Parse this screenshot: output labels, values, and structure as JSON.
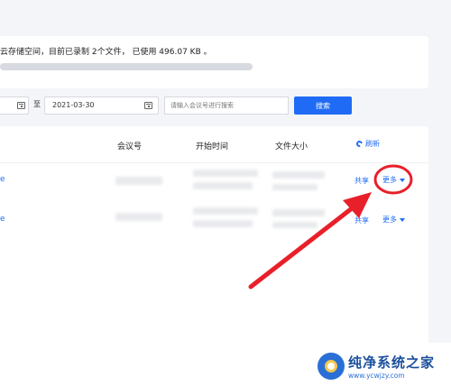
{
  "info": {
    "text": "云存储空间，目前已录制 2个文件， 已使用 496.07 KB 。"
  },
  "filters": {
    "start_date": "",
    "separator": "至",
    "end_date": "2021-03-30",
    "search_placeholder": "请输入会议号进行搜索",
    "search_button": "搜索"
  },
  "table": {
    "headers": {
      "meeting_id": "会议号",
      "start_time": "开始时间",
      "file_size": "文件大小"
    },
    "refresh_label": "刷新",
    "rows": [
      {
        "name_stub": "e",
        "share": "共享",
        "more": "更多"
      },
      {
        "name_stub": "e",
        "share": "共享",
        "more": "更多"
      }
    ]
  },
  "watermark": {
    "title": "纯净系统之家",
    "url": "www.ycwjzy.com"
  },
  "colors": {
    "accent": "#1f6bf5",
    "annotation": "#e8202a",
    "background": "#f4f5f8"
  },
  "storage": {
    "used_fraction": 1.0
  }
}
